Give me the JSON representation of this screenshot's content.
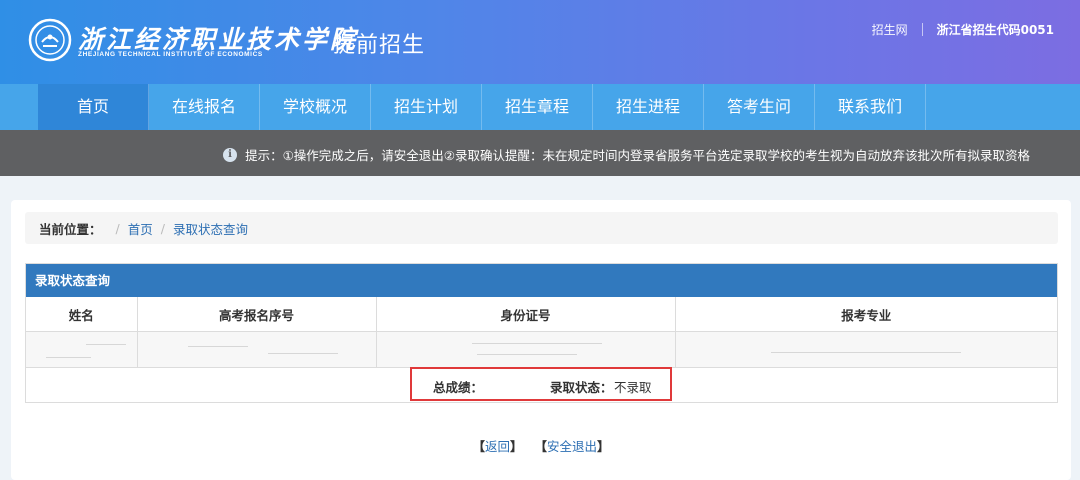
{
  "header": {
    "school_name": "浙江经济职业技术学院",
    "school_name_en": "ZHEJIANG TECHNICAL INSTITUTE OF ECONOMICS",
    "subtitle": "提前招生",
    "links": {
      "site": "招生网",
      "code": "浙江省招生代码0051"
    }
  },
  "nav": {
    "items": [
      {
        "label": "首页",
        "active": true
      },
      {
        "label": "在线报名"
      },
      {
        "label": "学校概况"
      },
      {
        "label": "招生计划"
      },
      {
        "label": "招生章程"
      },
      {
        "label": "招生进程"
      },
      {
        "label": "答考生问"
      },
      {
        "label": "联系我们"
      }
    ]
  },
  "tip": {
    "text": "提示：①操作完成之后，请安全退出②录取确认提醒：未在规定时间内登录省服务平台选定录取学校的考生视为自动放弃该批次所有拟录取资格"
  },
  "breadcrumb": {
    "label": "当前位置：",
    "items": [
      "首页",
      "录取状态查询"
    ]
  },
  "panel": {
    "title": "录取状态查询",
    "columns": [
      "姓名",
      "高考报名序号",
      "身份证号",
      "报考专业"
    ],
    "summary": {
      "score_label": "总成绩：",
      "status_label": "录取状态：",
      "status_value": "不录取"
    }
  },
  "actions": {
    "back": "返回",
    "logout": "安全退出"
  },
  "colors": {
    "header_gradient_start": "#2f8fe6",
    "header_gradient_end": "#7c6de2",
    "nav_bg": "#46a5ea",
    "nav_active": "#2f86d8",
    "panel_head": "#3179be",
    "highlight_border": "#e0393a"
  }
}
